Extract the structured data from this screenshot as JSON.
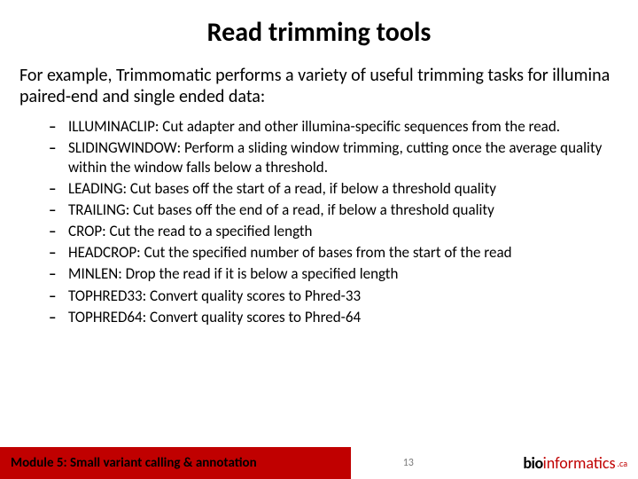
{
  "title": "Read trimming tools",
  "intro": "For example, Trimmomatic performs a variety of useful trimming tasks for illumina paired-end and single ended data:",
  "items": [
    {
      "term": "ILLUMINACLIP:",
      "desc": " Cut adapter and other illumina-specific sequences from the read."
    },
    {
      "term": "SLIDINGWINDOW:",
      "desc": " Perform a sliding window trimming, cutting once the average quality within the window falls below a threshold."
    },
    {
      "term": "LEADING:",
      "desc": " Cut bases off the start of a read, if below a threshold quality"
    },
    {
      "term": "TRAILING:",
      "desc": " Cut bases off the end of a read, if below a threshold quality"
    },
    {
      "term": "CROP:",
      "desc": " Cut the read to a specified length"
    },
    {
      "term": "HEADCROP:",
      "desc": " Cut the specified number of bases from the start of the read"
    },
    {
      "term": "MINLEN:",
      "desc": " Drop the read if it is below a specified length"
    },
    {
      "term": "TOPHRED33:",
      "desc": " Convert quality scores to Phred-33"
    },
    {
      "term": "TOPHRED64:",
      "desc": " Convert quality scores to Phred-64"
    }
  ],
  "footer": {
    "module": "Module 5: Small variant calling & annotation",
    "page": "13",
    "brand_bold": "bio",
    "brand_color": "informatics",
    "brand_suffix": ".ca"
  }
}
